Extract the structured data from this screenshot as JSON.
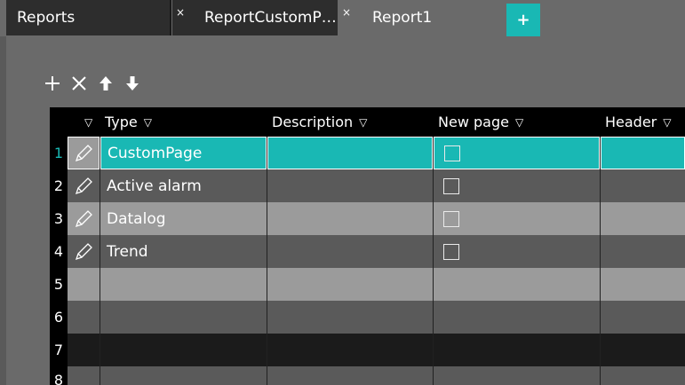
{
  "tabs": [
    {
      "label": "Reports"
    },
    {
      "label": "ReportCustomP…",
      "close": "×"
    },
    {
      "label": "Report1",
      "close": "×"
    }
  ],
  "add_tab_label": "+",
  "toolbar": {
    "add": "+",
    "delete": "✕",
    "move_up": "🡅",
    "move_down": "🡇"
  },
  "grid": {
    "columns": [
      {
        "label": "",
        "filter": "▽"
      },
      {
        "label": "Type",
        "filter": "▽"
      },
      {
        "label": "Description",
        "filter": "▽"
      },
      {
        "label": "New page",
        "filter": "▽"
      },
      {
        "label": "Header",
        "filter": "▽"
      }
    ],
    "rows": [
      {
        "num": "1",
        "type": "CustomPage",
        "description": "",
        "new_page": false
      },
      {
        "num": "2",
        "type": "Active alarm",
        "description": "",
        "new_page": false
      },
      {
        "num": "3",
        "type": "Datalog",
        "description": "",
        "new_page": false
      },
      {
        "num": "4",
        "type": "Trend",
        "description": "",
        "new_page": false
      },
      {
        "num": "5",
        "type": "",
        "description": ""
      },
      {
        "num": "6",
        "type": "",
        "description": ""
      },
      {
        "num": "7",
        "type": "",
        "description": ""
      },
      {
        "num": "8",
        "type": "",
        "description": ""
      }
    ]
  },
  "colors": {
    "accent": "#19b8b4",
    "row_dark": "#5a5a5a",
    "row_light": "#9b9b9b",
    "row_black": "#1b1b1b"
  }
}
